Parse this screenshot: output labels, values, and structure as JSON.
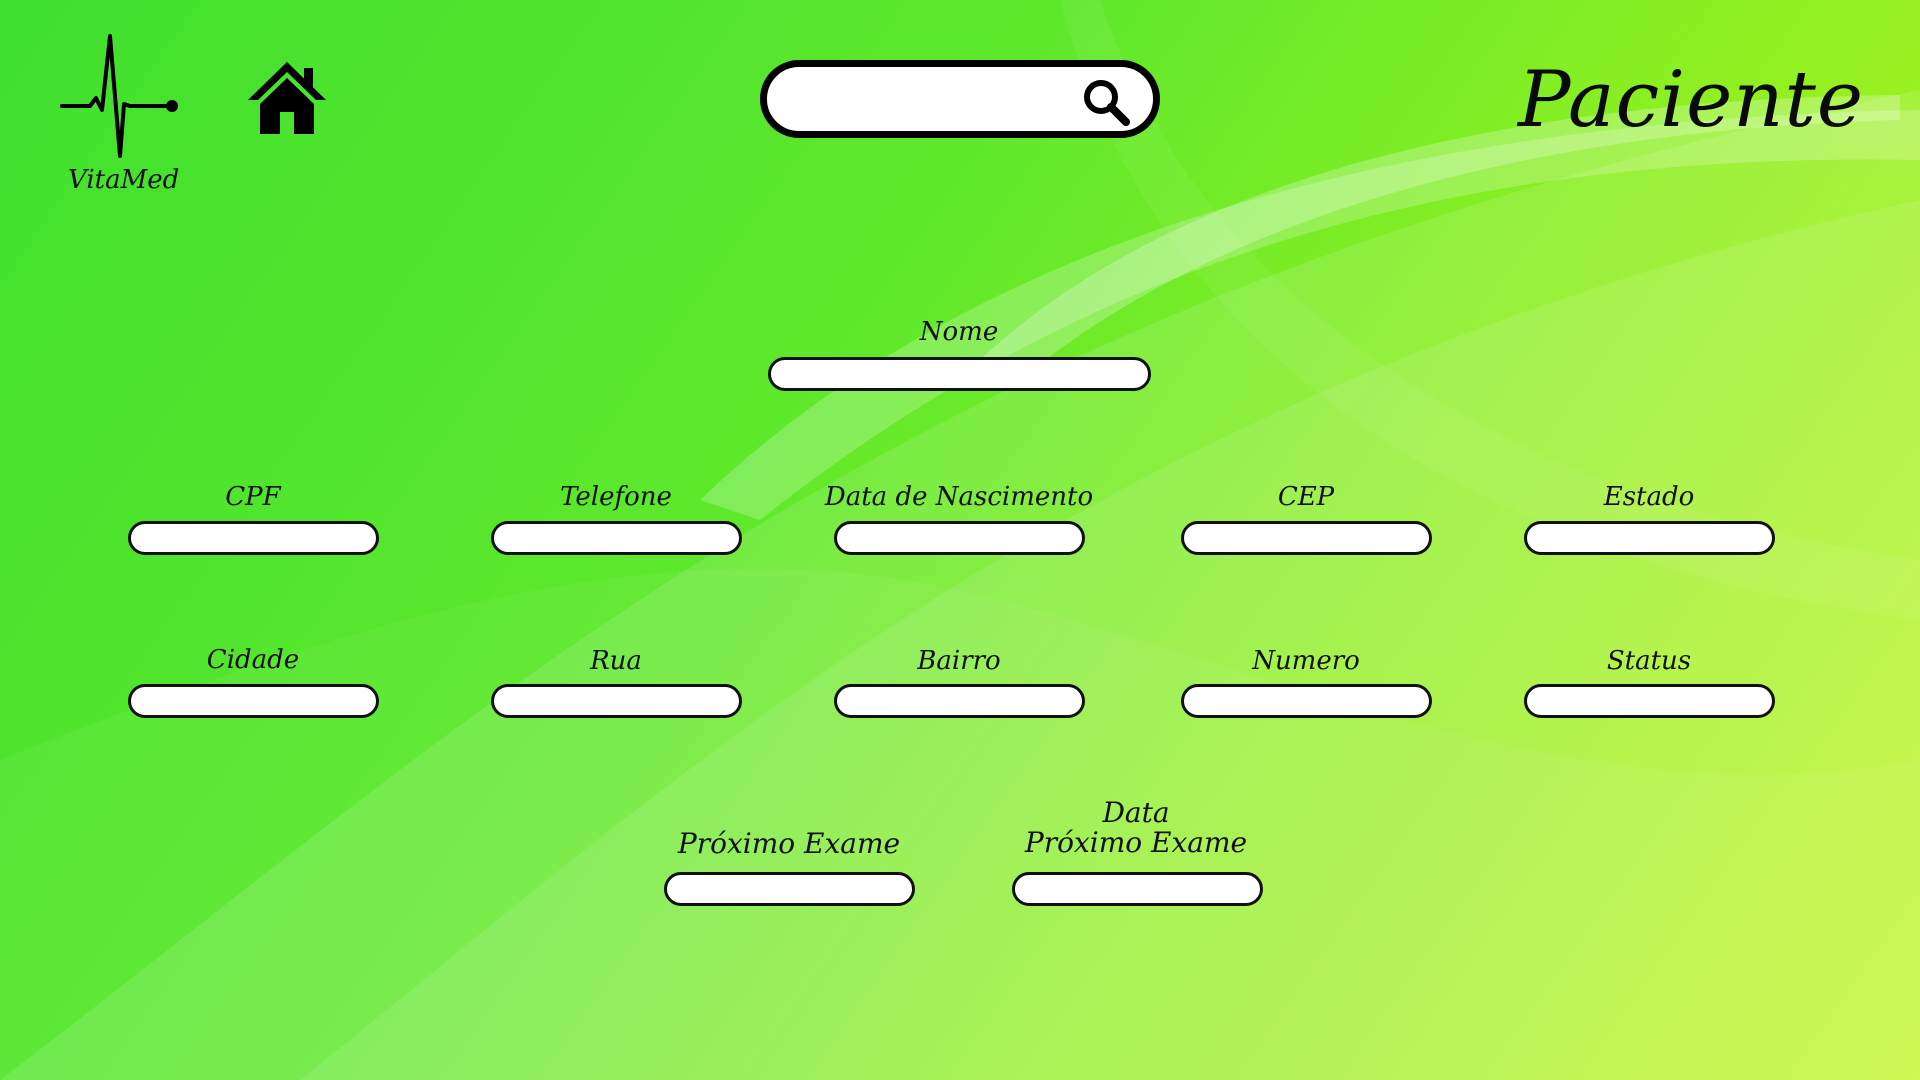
{
  "app": {
    "logo_text": "VitaMed",
    "page_title": "Paciente"
  },
  "icons": {
    "logo": "heartbeat-pulse-icon",
    "home": "home-icon",
    "search": "search-icon"
  },
  "search": {
    "value": "",
    "placeholder": ""
  },
  "form": {
    "nome": {
      "label": "Nome",
      "value": ""
    },
    "cpf": {
      "label": "CPF",
      "value": ""
    },
    "telefone": {
      "label": "Telefone",
      "value": ""
    },
    "data_nascimento": {
      "label": "Data de Nascimento",
      "value": ""
    },
    "cep": {
      "label": "CEP",
      "value": ""
    },
    "estado": {
      "label": "Estado",
      "value": ""
    },
    "cidade": {
      "label": "Cidade",
      "value": ""
    },
    "rua": {
      "label": "Rua",
      "value": ""
    },
    "bairro": {
      "label": "Bairro",
      "value": ""
    },
    "numero": {
      "label": "Numero",
      "value": ""
    },
    "status": {
      "label": "Status",
      "value": ""
    },
    "proximo_exame": {
      "label": "Próximo Exame",
      "value": ""
    },
    "data_proximo_exame": {
      "label_line1": "Data",
      "label_line2": "Próximo Exame",
      "value": ""
    }
  },
  "colors": {
    "background_start": "#3fe02f",
    "background_end": "#c2f51c",
    "input_border": "#111111",
    "input_fill": "#ffffff"
  }
}
